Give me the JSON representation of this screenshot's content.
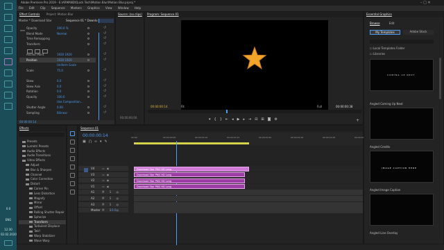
{
  "taskbar": {
    "time": "12:30",
    "date": "02.02.2020",
    "lang": "ENG",
    "volume_pct": "0.0",
    "accent": "#1a4d57"
  },
  "titlebar": "Adobe Premiere Pro 2019 - E:\\ARMAND\\Quick Tech\\Motion Blur\\Motion Blur.prproj *",
  "menu": [
    "File",
    "Edit",
    "Clip",
    "Sequence",
    "Markers",
    "Graphics",
    "View",
    "Window",
    "Help"
  ],
  "effect_controls": {
    "tabs": [
      "Effect Controls",
      "Project: Motion Blur"
    ],
    "source_label": "Master * Download Star",
    "sequence_label": "Sequence 01 * Downlo...",
    "rows": [
      {
        "name": "Opacity",
        "value": "100.0 %"
      },
      {
        "name": "Blend Mode",
        "value": "Normal"
      },
      {
        "name": "Time Remapping",
        "value": ""
      },
      {
        "name": "Transform",
        "value": ""
      },
      {
        "name": "",
        "value": ""
      },
      {
        "name": "Anchor Point",
        "value": "1920     1920"
      },
      {
        "name": "Position",
        "value": "1920     1920",
        "selected": true
      },
      {
        "name": "",
        "value": "Uniform Scale"
      },
      {
        "name": "Scale",
        "value": "75.0"
      },
      {
        "name": "",
        "value": ""
      },
      {
        "name": "Skew",
        "value": "0.0"
      },
      {
        "name": "Skew Axis",
        "value": "0.0"
      },
      {
        "name": "Rotation",
        "value": "0.0"
      },
      {
        "name": "Opacity",
        "value": "100.0"
      },
      {
        "name": "",
        "value": "Use Composition..."
      },
      {
        "name": "Shutter Angle",
        "value": "0.00"
      },
      {
        "name": "Sampling",
        "value": "Bilinear"
      }
    ],
    "timecode": "00:00:00:14"
  },
  "source_monitor": {
    "tab": "Source: (no clips)",
    "timecode": "00;00;00;00"
  },
  "program_monitor": {
    "tab": "Program: Sequence 01",
    "timecode": "00:00:00:14",
    "fit": "Fit",
    "quality": "Full",
    "duration": "00:00:00:38",
    "star_color": "#f2a52b"
  },
  "effects_panel": {
    "tab": "Effects",
    "items": [
      {
        "label": "Presets",
        "indent": 1
      },
      {
        "label": "Lumetri Presets",
        "indent": 1
      },
      {
        "label": "Audio Effects",
        "indent": 1
      },
      {
        "label": "Audio Transitions",
        "indent": 1
      },
      {
        "label": "Video Effects",
        "indent": 1
      },
      {
        "label": "Adjust",
        "indent": 2
      },
      {
        "label": "Blur & Sharpen",
        "indent": 2
      },
      {
        "label": "Channel",
        "indent": 2
      },
      {
        "label": "Color Correction",
        "indent": 2
      },
      {
        "label": "Distort",
        "indent": 2
      },
      {
        "label": "Corner Pin",
        "indent": 3
      },
      {
        "label": "Lens Distortion",
        "indent": 3
      },
      {
        "label": "Magnify",
        "indent": 3
      },
      {
        "label": "Mirror",
        "indent": 3
      },
      {
        "label": "Offset",
        "indent": 3
      },
      {
        "label": "Rolling Shutter Repair",
        "indent": 3
      },
      {
        "label": "Spherize",
        "indent": 3
      },
      {
        "label": "Transform",
        "indent": 3,
        "selected": true
      },
      {
        "label": "Turbulent Displace",
        "indent": 3
      },
      {
        "label": "Twirl",
        "indent": 3
      },
      {
        "label": "Warp Stabilizer",
        "indent": 3
      },
      {
        "label": "Wave Warp",
        "indent": 3
      }
    ]
  },
  "timeline": {
    "tab": "Sequence 01",
    "timecode": "00:00:00:14",
    "ruler": [
      "00:00",
      "00:00:00:05",
      "00:00:00:10",
      "00:00:00:15",
      "00:00:00:20",
      "00:00:01:00",
      "00:00:01:05",
      "00:00:01:10"
    ],
    "tracks": [
      "V4",
      "V3",
      "V2",
      "V1",
      "A1",
      "A2",
      "A3",
      "Master"
    ],
    "master_value": "0.0",
    "clips": [
      {
        "label": "Download Star PNG HD Long",
        "track": 0,
        "color": "#d07ad8"
      },
      {
        "label": "Download Star PNG HD Long",
        "track": 1,
        "color": "#9d3ea5"
      },
      {
        "label": "Download Star PNG HD Long",
        "track": 2,
        "color": "#9d3ea5"
      },
      {
        "label": "Download Star PNG HD Long",
        "track": 3,
        "color": "#9d3ea5"
      }
    ]
  },
  "essential_graphics": {
    "title": "Essential Graphics",
    "tabs": [
      "Browse",
      "Edit"
    ],
    "templates_btn": "My Templates",
    "adobe_stock_btn": "Adobe Stock",
    "local_templates": "Local Templates Folder",
    "libraries": "Libraries",
    "cards": [
      {
        "label": "Angled Coming Up Next",
        "preview": "COMING UP NEXT"
      },
      {
        "label": "Angled Credits",
        "preview": ""
      },
      {
        "label": "Angled Image Caption",
        "preview": "IMAGE CAPTION HERE"
      },
      {
        "label": "Angled Line Overlay",
        "preview": ""
      }
    ]
  }
}
